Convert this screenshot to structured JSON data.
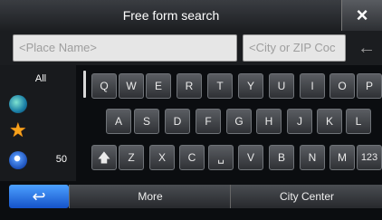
{
  "header": {
    "title": "Free form search",
    "close_icon": "×"
  },
  "inputs": {
    "place_name_placeholder": "<Place Name>",
    "city_zip_placeholder": "<City or ZIP Coc",
    "backspace_icon": "←"
  },
  "side_list": {
    "all_label": "All",
    "items": [
      {
        "icon": "globe-icon"
      },
      {
        "icon": "star-icon"
      },
      {
        "icon": "location-pin-icon",
        "count": "50"
      }
    ]
  },
  "keyboard": {
    "row1": [
      "Q",
      "W",
      "E",
      "R",
      "T",
      "Y",
      "U",
      "I",
      "O",
      "P"
    ],
    "row2": [
      "A",
      "S",
      "D",
      "F",
      "G",
      "H",
      "J",
      "K",
      "L"
    ],
    "row3": [
      "Z",
      "X",
      "C",
      "␣",
      "V",
      "B",
      "N",
      "M"
    ],
    "shift_icon": "🡅",
    "numbers_label": "123"
  },
  "bottom_bar": {
    "back_icon": "↩",
    "more_label": "More",
    "city_center_label": "City Center"
  }
}
